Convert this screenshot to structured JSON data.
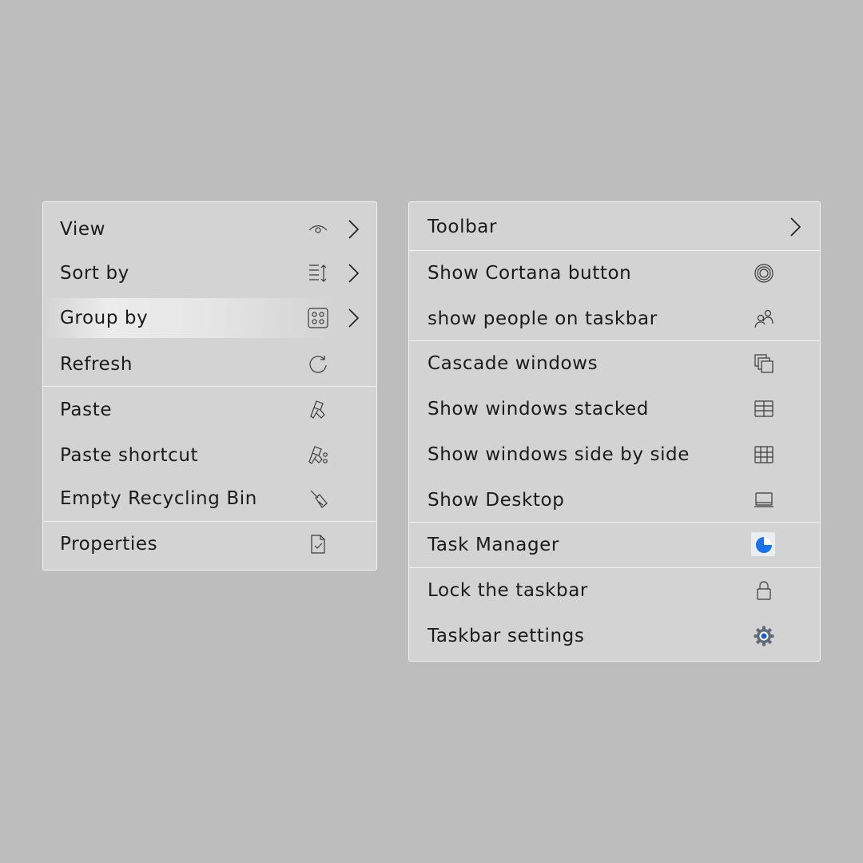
{
  "desktop_menu": {
    "items": [
      {
        "label": "View",
        "icon": "eye-icon",
        "submenu": true
      },
      {
        "label": "Sort by",
        "icon": "sort-icon",
        "submenu": true
      },
      {
        "label": "Group by",
        "icon": "group-icon",
        "submenu": true,
        "highlighted": true
      },
      {
        "label": "Refresh",
        "icon": "refresh-icon",
        "submenu": false
      },
      {
        "label": "Paste",
        "icon": "paste-icon",
        "submenu": false
      },
      {
        "label": "Paste shortcut",
        "icon": "paste-shortcut-icon",
        "submenu": false
      },
      {
        "label": "Empty Recycling Bin",
        "icon": "brush-icon",
        "submenu": false
      },
      {
        "label": "Properties",
        "icon": "document-check-icon",
        "submenu": false
      }
    ]
  },
  "taskbar_menu": {
    "items": [
      {
        "label": "Toolbar",
        "icon": "",
        "submenu": true
      },
      {
        "label": "Show Cortana button",
        "icon": "cortana-icon",
        "submenu": false
      },
      {
        "label": "show people on taskbar",
        "icon": "people-icon",
        "submenu": false
      },
      {
        "label": "Cascade windows",
        "icon": "cascade-icon",
        "submenu": false
      },
      {
        "label": "Show windows stacked",
        "icon": "stacked-windows-icon",
        "submenu": false
      },
      {
        "label": "Show windows side by side",
        "icon": "side-by-side-icon",
        "submenu": false
      },
      {
        "label": "Show Desktop",
        "icon": "laptop-icon",
        "submenu": false
      },
      {
        "label": "Task Manager",
        "icon": "task-manager-icon",
        "submenu": false
      },
      {
        "label": "Lock the taskbar",
        "icon": "lock-icon",
        "submenu": false
      },
      {
        "label": "Taskbar settings",
        "icon": "gear-icon",
        "submenu": false
      }
    ]
  },
  "colors": {
    "background": "#bdbdbd",
    "menu": "#d3d3d3",
    "border": "#f2f2f2",
    "accent": "#1a73e8"
  }
}
